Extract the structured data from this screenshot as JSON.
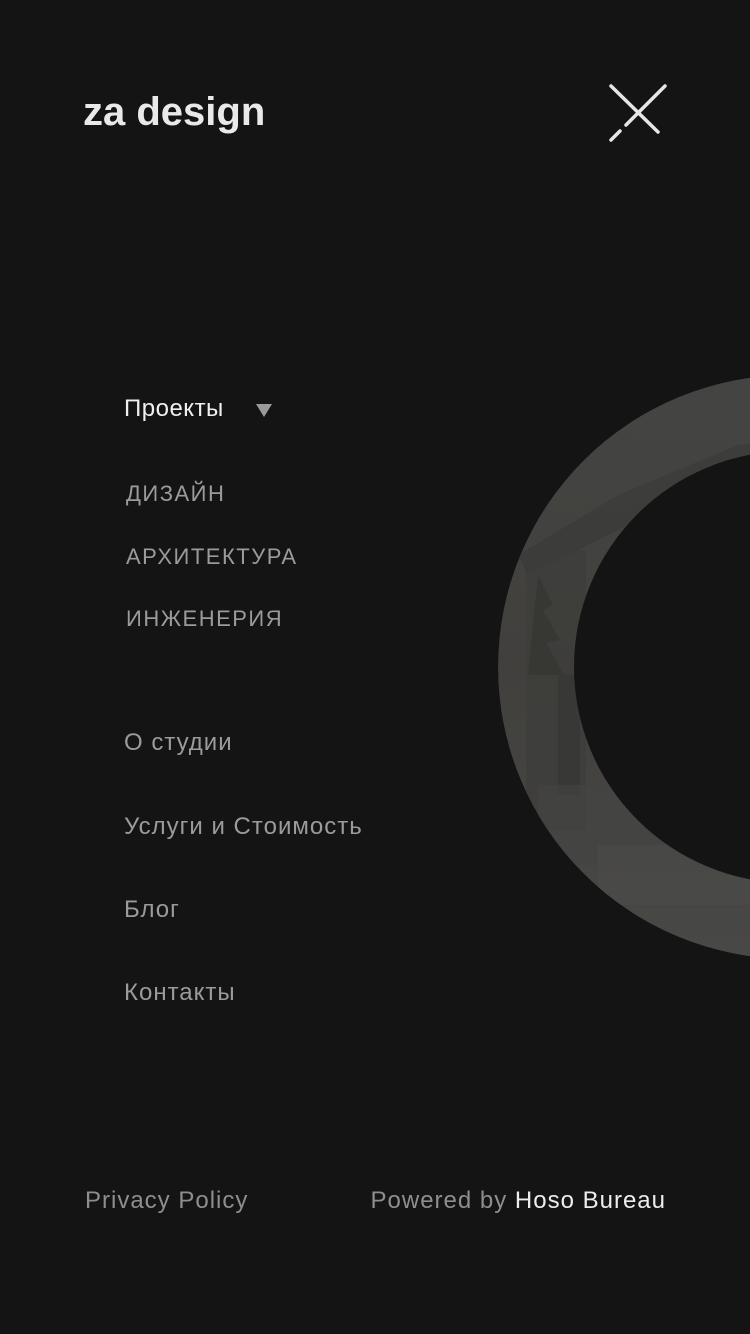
{
  "header": {
    "logo": "za design",
    "close_icon": "close-icon"
  },
  "menu": {
    "projects": {
      "label": "Проекты",
      "expanded": true,
      "icon": "caret-down-icon",
      "subitems": [
        "ДИЗАЙН",
        "АРХИТЕКТУРА",
        "ИНЖЕНЕРИЯ"
      ]
    },
    "items": [
      "О студии",
      "Услуги и Стоимость",
      "Блог",
      "Контакты"
    ]
  },
  "footer": {
    "privacy": "Privacy Policy",
    "powered_prefix": "Powered by ",
    "powered_brand": "Hoso Bureau"
  },
  "colors": {
    "background": "#141414",
    "text_primary": "#f0f0f0",
    "text_muted": "#9b9b9b",
    "ring": "#4a4a48"
  }
}
